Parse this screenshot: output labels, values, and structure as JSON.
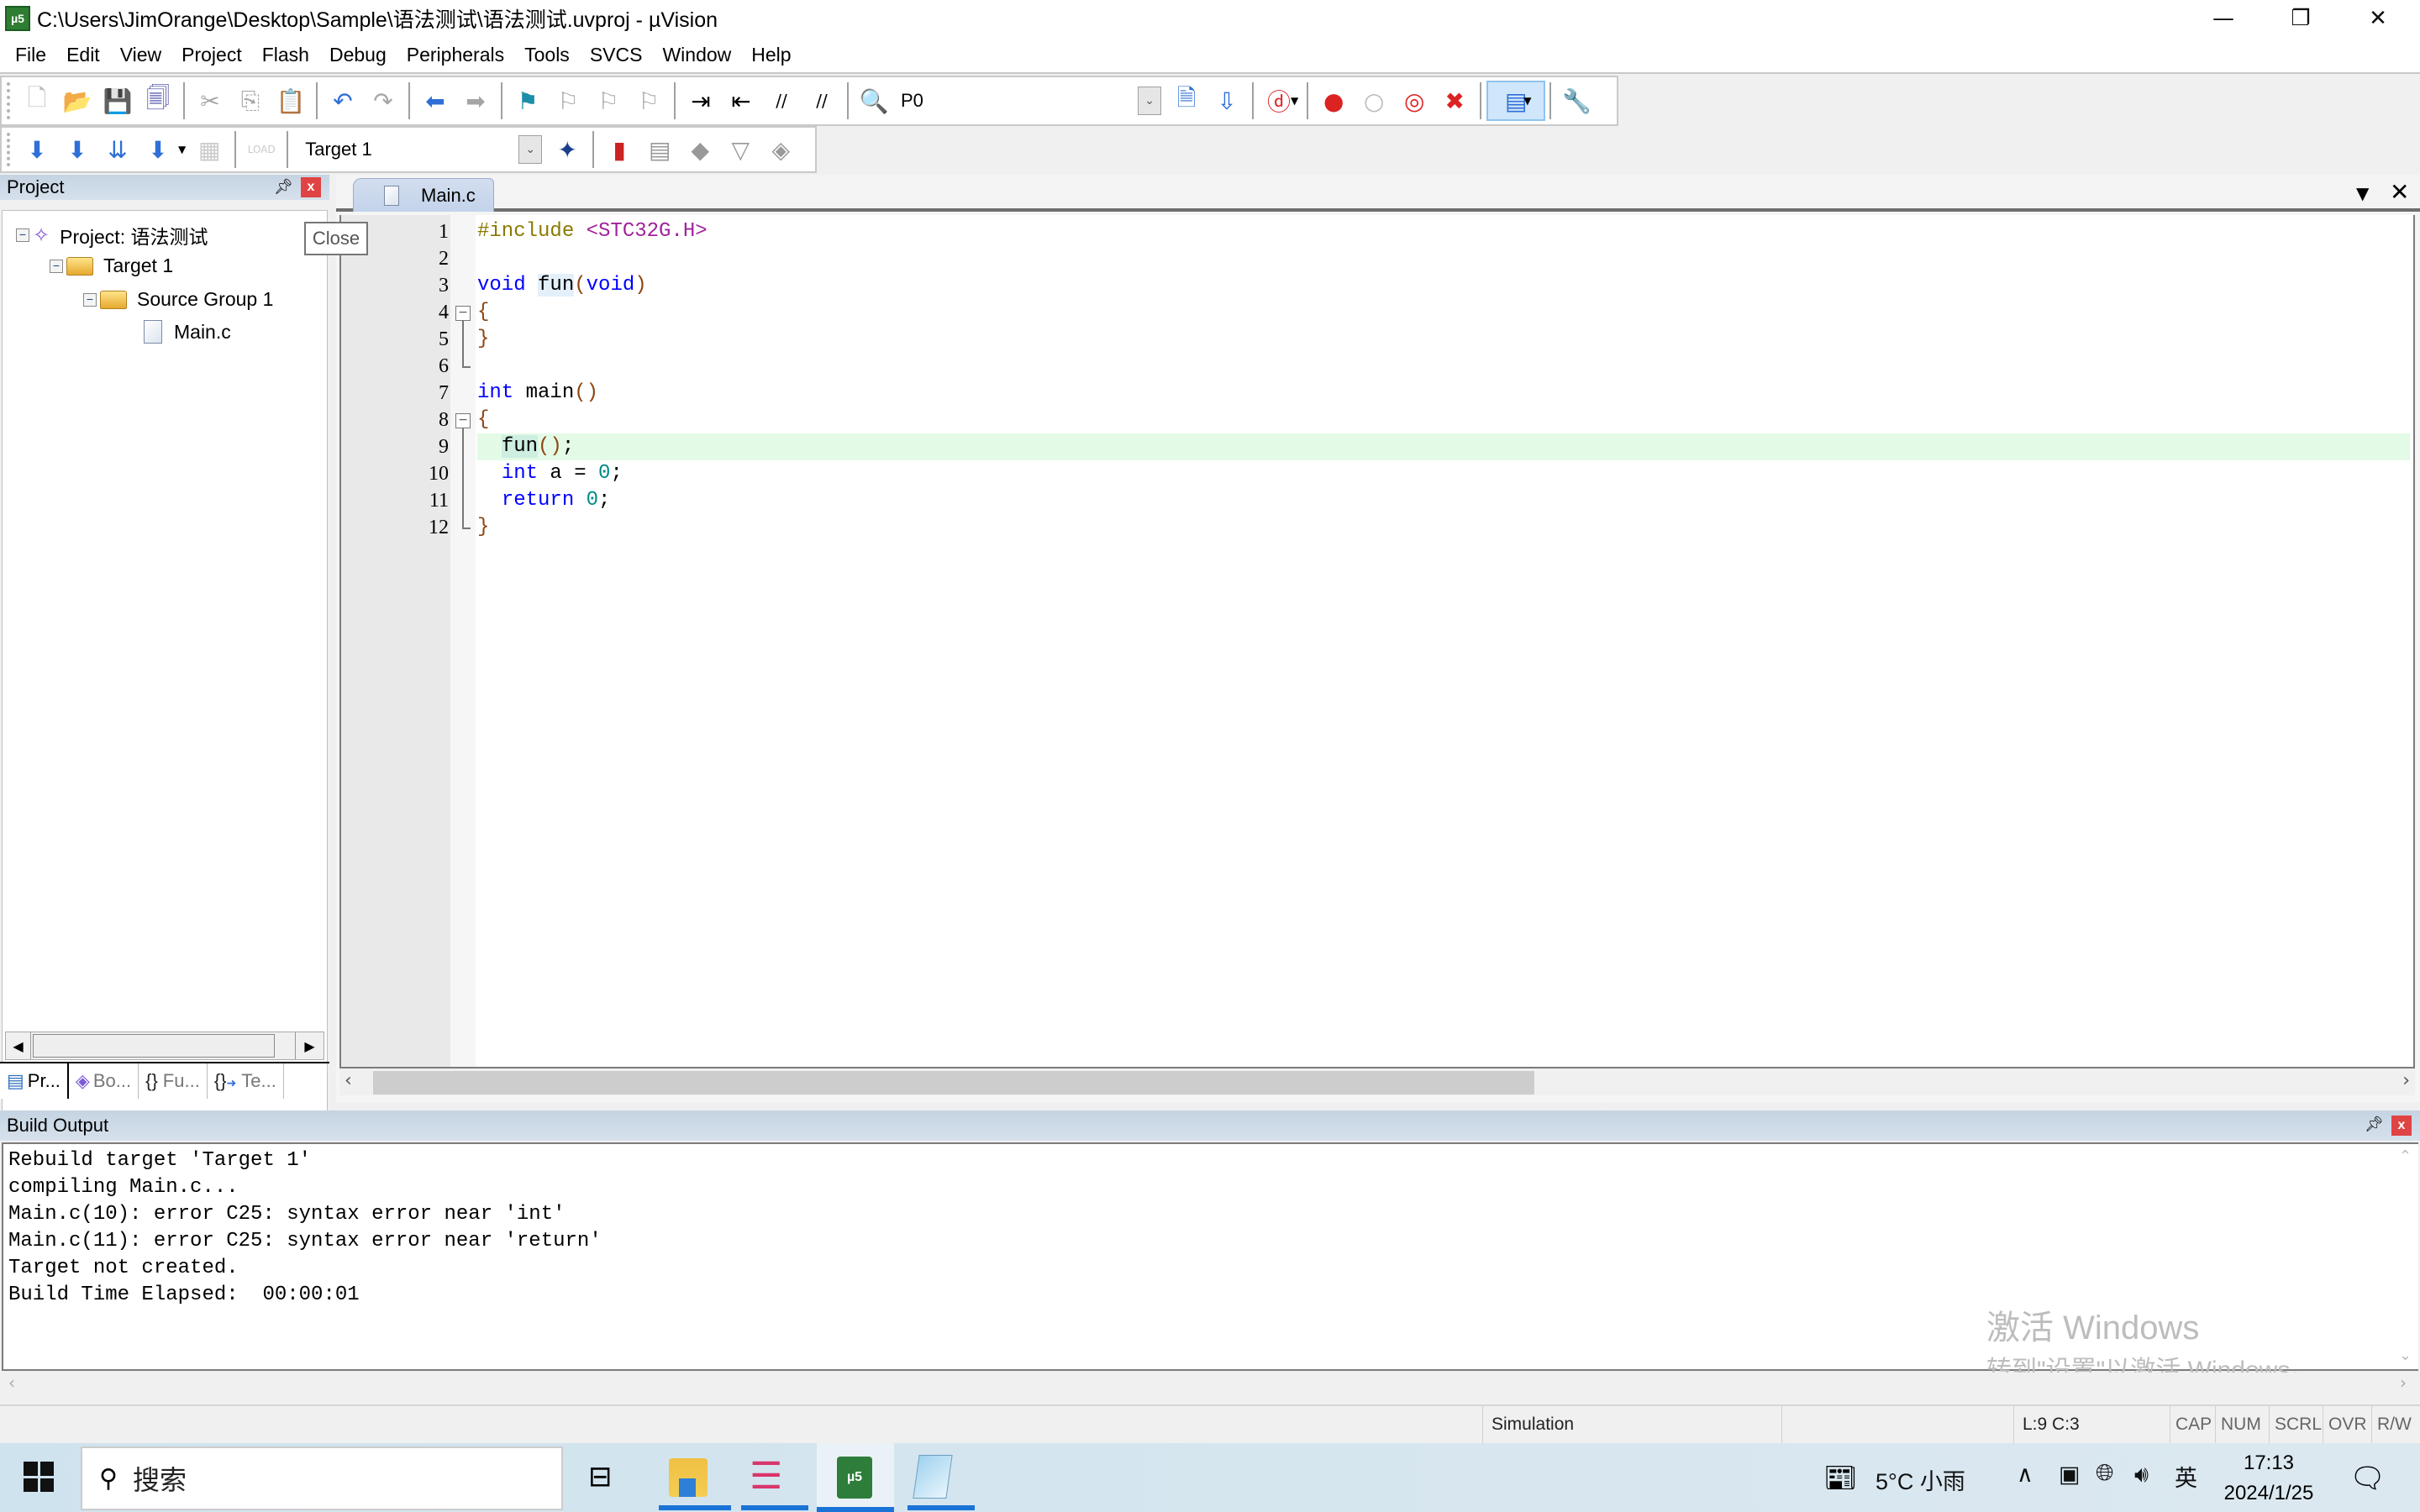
{
  "window": {
    "title": "C:\\Users\\JimOrange\\Desktop\\Sample\\语法测试\\语法测试.uvproj - µVision",
    "app_icon_label": "µ5",
    "controls": {
      "minimize": "—",
      "restore": "❐",
      "close": "✕"
    }
  },
  "menu": [
    "File",
    "Edit",
    "View",
    "Project",
    "Flash",
    "Debug",
    "Peripherals",
    "Tools",
    "SVCS",
    "Window",
    "Help"
  ],
  "toolbar1": {
    "buttons": [
      {
        "name": "new-file",
        "glyph": "🗋",
        "enabled": true
      },
      {
        "name": "open-file",
        "glyph": "📂",
        "enabled": true
      },
      {
        "name": "save",
        "glyph": "💾",
        "enabled": true
      },
      {
        "name": "save-all",
        "glyph": "🗐",
        "enabled": true
      },
      {
        "name": "cut",
        "glyph": "✂",
        "enabled": false
      },
      {
        "name": "copy",
        "glyph": "⎘",
        "enabled": false
      },
      {
        "name": "paste",
        "glyph": "📋",
        "enabled": true
      },
      {
        "name": "undo",
        "glyph": "↶",
        "enabled": true
      },
      {
        "name": "redo",
        "glyph": "↷",
        "enabled": false
      },
      {
        "name": "navigate-back",
        "glyph": "⬅",
        "enabled": true
      },
      {
        "name": "navigate-forward",
        "glyph": "➡",
        "enabled": false
      },
      {
        "name": "bookmark-toggle",
        "glyph": "⚑",
        "enabled": true
      },
      {
        "name": "bookmark-prev",
        "glyph": "⚐",
        "enabled": false
      },
      {
        "name": "bookmark-next",
        "glyph": "⚐",
        "enabled": false
      },
      {
        "name": "bookmark-clear",
        "glyph": "⚐",
        "enabled": false
      },
      {
        "name": "indent",
        "glyph": "⇥",
        "enabled": true
      },
      {
        "name": "unindent",
        "glyph": "⇤",
        "enabled": true
      },
      {
        "name": "comment",
        "glyph": "//",
        "enabled": true
      },
      {
        "name": "uncomment",
        "glyph": "//",
        "enabled": true
      },
      {
        "name": "find-in-files",
        "glyph": "🔍",
        "enabled": true
      }
    ],
    "find_value": "P0",
    "right_buttons": [
      {
        "name": "find",
        "glyph": "🗎"
      },
      {
        "name": "incremental-find",
        "glyph": "⇩"
      },
      {
        "name": "debug-session",
        "glyph": "ⓓ"
      },
      {
        "name": "breakpoint-insert",
        "glyph": "●"
      },
      {
        "name": "breakpoint-enable",
        "glyph": "○"
      },
      {
        "name": "breakpoint-disable-all",
        "glyph": "◎"
      },
      {
        "name": "breakpoint-kill-all",
        "glyph": "✖"
      },
      {
        "name": "window-layout",
        "glyph": "▤"
      },
      {
        "name": "configure",
        "glyph": "🔧"
      }
    ]
  },
  "toolbar2": {
    "buttons": [
      {
        "name": "translate",
        "glyph": "⬇",
        "enabled": true
      },
      {
        "name": "build",
        "glyph": "⬇",
        "enabled": true
      },
      {
        "name": "rebuild",
        "glyph": "⇊",
        "enabled": true
      },
      {
        "name": "batch-build",
        "glyph": "⬇",
        "enabled": true
      },
      {
        "name": "stop-build",
        "glyph": "▦",
        "enabled": false
      },
      {
        "name": "download",
        "glyph": "LOAD",
        "enabled": false
      }
    ],
    "target_select": "Target 1",
    "after_buttons": [
      {
        "name": "target-options",
        "glyph": "✦"
      },
      {
        "name": "file-extensions",
        "glyph": "▮"
      },
      {
        "name": "manage-multi-project",
        "glyph": "▤"
      },
      {
        "name": "select-software-packs",
        "glyph": "◆"
      },
      {
        "name": "pack-installer",
        "glyph": "▽"
      },
      {
        "name": "manage-runtime",
        "glyph": "◈"
      }
    ]
  },
  "project_panel": {
    "title": "Project",
    "tooltip": "Close",
    "tree": [
      {
        "label": "Project: 语法测试",
        "level": 0,
        "type": "project",
        "expanded": true
      },
      {
        "label": "Target 1",
        "level": 1,
        "type": "target",
        "expanded": true
      },
      {
        "label": "Source Group 1",
        "level": 2,
        "type": "group",
        "expanded": true
      },
      {
        "label": "Main.c",
        "level": 3,
        "type": "file"
      }
    ],
    "bottom_tabs": [
      {
        "label": "Pr...",
        "icon": "project-icon",
        "active": true
      },
      {
        "label": "Bo...",
        "icon": "books-icon",
        "active": false
      },
      {
        "label": "Fu...",
        "icon": "functions-icon",
        "glyph": "{}",
        "active": false
      },
      {
        "label": "Te...",
        "icon": "templates-icon",
        "glyph": "0",
        "active": false
      }
    ]
  },
  "editor": {
    "tab": "Main.c",
    "current_line": 9,
    "lines": [
      {
        "n": "1",
        "html": "<span class=\"pp\">#include</span> <span class=\"hdr\">&lt;STC32G.H&gt;</span>"
      },
      {
        "n": "2",
        "html": ""
      },
      {
        "n": "3",
        "html": "<span class=\"kw\">void</span> <span style=\"background:#e3f0fb\">fun</span><span class=\"br\">(</span><span class=\"kw\">void</span><span class=\"br\">)</span>"
      },
      {
        "n": "4",
        "html": "<span class=\"br\">{</span>"
      },
      {
        "n": "5",
        "html": "<span class=\"br\">}</span>"
      },
      {
        "n": "6",
        "html": ""
      },
      {
        "n": "7",
        "html": "<span class=\"kw\">int</span> main<span class=\"br\">()</span>"
      },
      {
        "n": "8",
        "html": "<span class=\"br\">{</span>"
      },
      {
        "n": "9",
        "html": "  <span style=\"background:#cdeee0\">fun</span><span class=\"br\">()</span>;"
      },
      {
        "n": "10",
        "html": "  <span class=\"kw\">int</span> a = <span class=\"num\">0</span>;"
      },
      {
        "n": "11",
        "html": "  <span class=\"kw\">return</span> <span class=\"num\">0</span>;"
      },
      {
        "n": "12",
        "html": "<span class=\"br\">}</span>"
      }
    ]
  },
  "build_output": {
    "title": "Build Output",
    "lines": [
      "Rebuild target 'Target 1'",
      "compiling Main.c...",
      "Main.c(10): error C25: syntax error near 'int'",
      "Main.c(11): error C25: syntax error near 'return'",
      "Target not created.",
      "Build Time Elapsed:  00:00:01"
    ]
  },
  "watermark": {
    "line1": "激活 Windows",
    "line2": "转到\"设置\"以激活 Windows。"
  },
  "status_bar": {
    "mode": "Simulation",
    "position": "L:9 C:3",
    "indicators": [
      "CAP",
      "NUM",
      "SCRL",
      "OVR",
      "R/W"
    ]
  },
  "taskbar": {
    "search_placeholder": "搜索",
    "weather": "5°C 小雨",
    "ime": "英",
    "time": "17:13",
    "date": "2024/1/25",
    "apps": [
      "task-view",
      "file-explorer",
      "stc-isp",
      "keil-uvision",
      "notepad"
    ]
  }
}
